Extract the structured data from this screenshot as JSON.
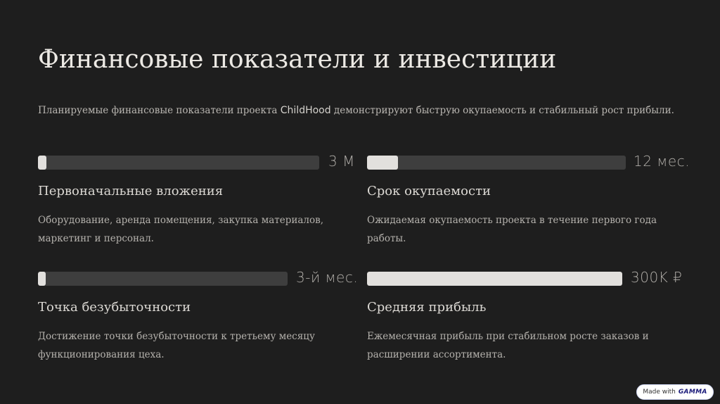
{
  "title": "Финансовые показатели и инвестиции",
  "subtitle": {
    "before": "Планируемые финансовые показатели проекта ",
    "brand": "ChildHood",
    "after": " демонстрируют быструю окупаемость и стабильный рост прибыли."
  },
  "metrics": [
    {
      "value": "3 М",
      "fill": 0.03,
      "title": "Первоначальные вложения",
      "description": "Оборудование, аренда помещения, закупка материалов, маркетинг и персонал."
    },
    {
      "value": "12 мес.",
      "fill": 0.12,
      "title": "Срок окупаемости",
      "description": "Ожидаемая окупаемость проекта в течение первого года работы."
    },
    {
      "value": "3-й мес.",
      "fill": 0.03,
      "title": "Точка безубыточности",
      "description": "Достижение точки безубыточности к третьему месяцу функционирования цеха."
    },
    {
      "value": "300K ₽",
      "fill": 1.0,
      "title": "Средняя прибыль",
      "description": "Ежемесячная прибыль при стабильном росте заказов и расширении ассортимента."
    }
  ],
  "badge": {
    "prefix": "Made with",
    "logo": "GAMMA"
  },
  "colors": {
    "background": "#1e1e1e",
    "track": "#3e3e3e",
    "fill": "#e2e0dd"
  }
}
